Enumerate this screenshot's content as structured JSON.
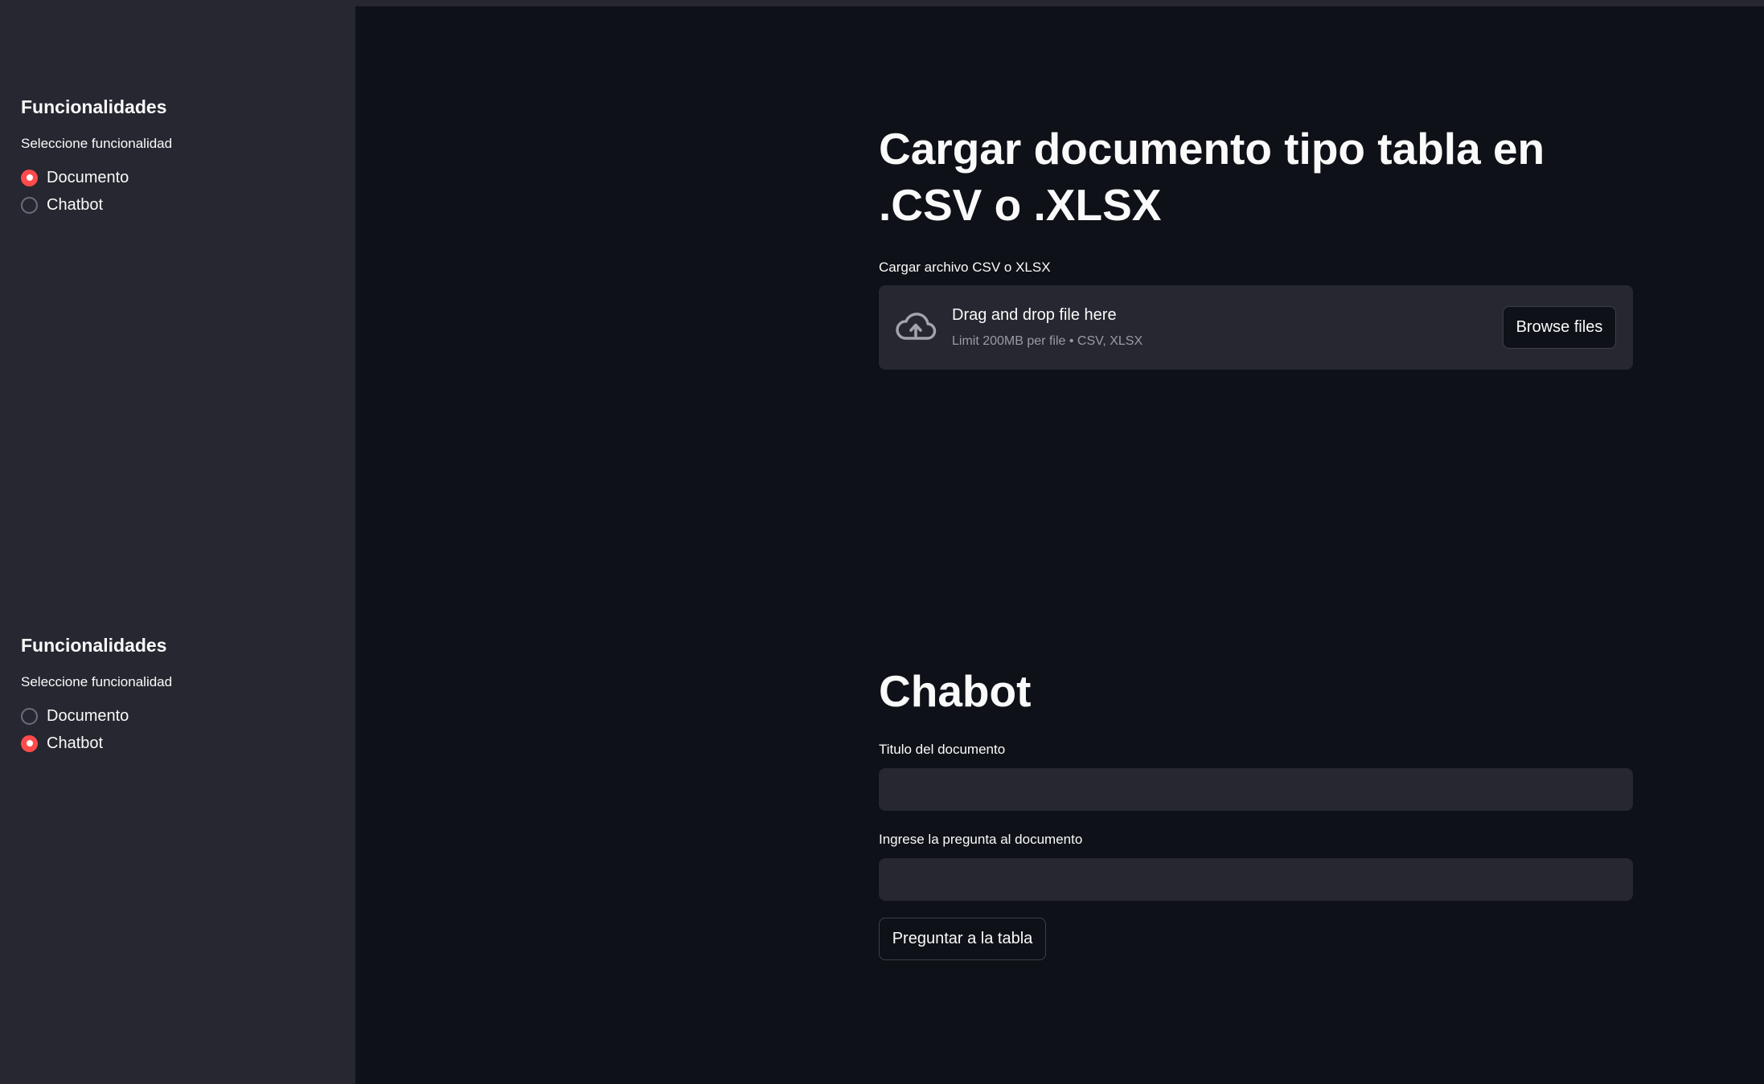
{
  "sidebar": {
    "sections": [
      {
        "title": "Funcionalidades",
        "radio_label": "Seleccione funcionalidad",
        "options": [
          {
            "label": "Documento",
            "selected": true
          },
          {
            "label": "Chatbot",
            "selected": false
          }
        ]
      },
      {
        "title": "Funcionalidades",
        "radio_label": "Seleccione funcionalidad",
        "options": [
          {
            "label": "Documento",
            "selected": false
          },
          {
            "label": "Chatbot",
            "selected": true
          }
        ]
      }
    ]
  },
  "document": {
    "heading": "Cargar documento tipo tabla en .CSV o .XLSX",
    "uploader_label": "Cargar archivo CSV o XLSX",
    "drop_text": "Drag and drop file here",
    "limit_text": "Limit 200MB per file • CSV, XLSX",
    "browse_label": "Browse files"
  },
  "chat": {
    "heading": "Chabot",
    "title_field_label": "Titulo del documento",
    "title_field_value": "",
    "question_field_label": "Ingrese la pregunta al documento",
    "question_field_value": "",
    "ask_button_label": "Preguntar a la tabla"
  },
  "colors": {
    "accent": "#ff4b4b",
    "background": "#0e1117",
    "sidebar": "#262730"
  },
  "icons": {
    "upload": "cloud-upload-icon"
  }
}
